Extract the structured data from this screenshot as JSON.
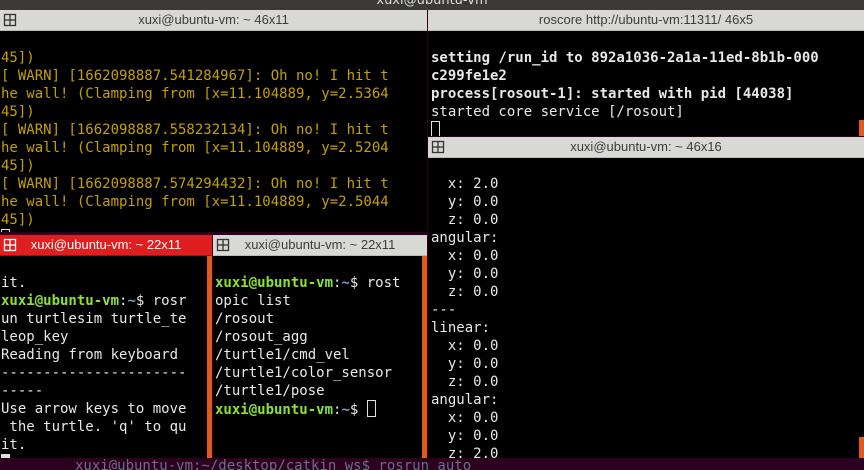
{
  "desktop": {
    "top_title": "xuxi@ubuntu-vm",
    "background_line": "xuxi@ubuntu-vm:~/desktop/catkin_ws$ rosrun auto"
  },
  "windows": {
    "w1": {
      "title": "xuxi@ubuntu-vm: ~ 46x11",
      "lines": [
        "45])",
        "[ WARN] [1662098887.541284967]: Oh no! I hit t",
        "he wall! (Clamping from [x=11.104889, y=2.5364",
        "45])",
        "[ WARN] [1662098887.558232134]: Oh no! I hit t",
        "he wall! (Clamping from [x=11.104889, y=2.5204",
        "45])",
        "[ WARN] [1662098887.574294432]: Oh no! I hit t",
        "he wall! (Clamping from [x=11.104889, y=2.5044",
        "45])"
      ]
    },
    "w2": {
      "title": "roscore http://ubuntu-vm:11311/ 46x5",
      "lines": [
        "setting /run_id to 892a1036-2a1a-11ed-8b1b-000",
        "c299fe1e2",
        "process[rosout-1]: started with pid [44038]",
        "started core service [/rosout]"
      ]
    },
    "w3": {
      "title": "xuxi@ubuntu-vm: ~ 46x16",
      "lines": [
        "  x: 2.0",
        "  y: 0.0",
        "  z: 0.0",
        "angular:",
        "  x: 0.0",
        "  y: 0.0",
        "  z: 0.0",
        "---",
        "linear:",
        "  x: 0.0",
        "  y: 0.0",
        "  z: 0.0",
        "angular:",
        "  x: 0.0",
        "  y: 0.0",
        "  z: 2.0"
      ]
    },
    "w4": {
      "title": "xuxi@ubuntu-vm: ~ 22x11",
      "line0": "it.",
      "prompt_user": "xuxi@ubuntu-vm",
      "prompt_sep": ":",
      "prompt_path": "~",
      "prompt_end": "$ rosr",
      "lines": [
        "un turtlesim turtle_te",
        "leop_key",
        "Reading from keyboard",
        "----------------------",
        "-----",
        "Use arrow keys to move",
        " the turtle. 'q' to qu",
        "it."
      ]
    },
    "w5": {
      "title": "xuxi@ubuntu-vm: ~ 22x11",
      "prompt_user": "xuxi@ubuntu-vm",
      "prompt_sep": ":",
      "prompt_path": "~",
      "prompt_end": "$ rost",
      "lines": [
        "opic list",
        "/rosout",
        "/rosout_agg",
        "/turtle1/cmd_vel",
        "/turtle1/color_sensor",
        "/turtle1/pose"
      ],
      "prompt2_user": "xuxi@ubuntu-vm",
      "prompt2_sep": ":",
      "prompt2_path": "~",
      "prompt2_end": "$ "
    }
  },
  "colors": {
    "active_titlebar": "#dd1f1f",
    "inactive_titlebar": "#d8d8d5",
    "warn_text": "#c4a000",
    "prompt_user": "#8ae234",
    "prompt_path": "#729fcf",
    "scrollbar": "#e05a1e"
  }
}
